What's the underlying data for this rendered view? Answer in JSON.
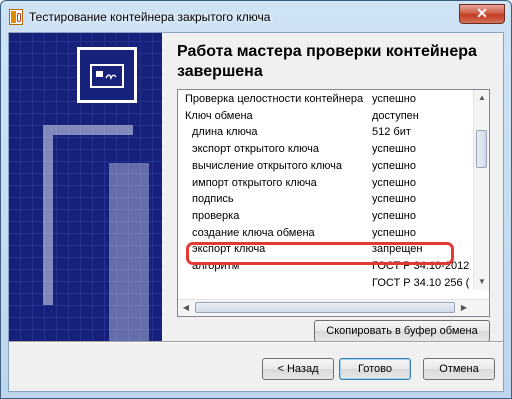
{
  "window": {
    "title": "Тестирование контейнера закрытого ключа",
    "close_label": "✕"
  },
  "heading": "Работа мастера проверки контейнера завершена",
  "results": [
    {
      "name": "Проверка целостности контейнера",
      "value": "успешно",
      "indent": 0
    },
    {
      "name": "Ключ обмена",
      "value": "доступен",
      "indent": 0
    },
    {
      "name": "длина ключа",
      "value": "512 бит",
      "indent": 1
    },
    {
      "name": "экспорт открытого ключа",
      "value": "успешно",
      "indent": 1
    },
    {
      "name": "вычисление открытого ключа",
      "value": "успешно",
      "indent": 1
    },
    {
      "name": "импорт открытого ключа",
      "value": "успешно",
      "indent": 1
    },
    {
      "name": "подпись",
      "value": "успешно",
      "indent": 1
    },
    {
      "name": "проверка",
      "value": "успешно",
      "indent": 1
    },
    {
      "name": "создание ключа обмена",
      "value": "успешно",
      "indent": 1
    },
    {
      "name": "экспорт ключа",
      "value": "запрещен",
      "indent": 1,
      "highlighted": true
    },
    {
      "name": "алгоритм",
      "value": "ГОСТ Р 34.10-2012",
      "indent": 1
    },
    {
      "name": "",
      "value": "ГОСТ Р 34.10 256 (",
      "indent": 1
    }
  ],
  "buttons": {
    "copy": "Скопировать в буфер обмена",
    "back": "< Назад",
    "done": "Готово",
    "cancel": "Отмена"
  },
  "colors": {
    "highlight": "#e23a32",
    "side_panel": "#17207a"
  }
}
